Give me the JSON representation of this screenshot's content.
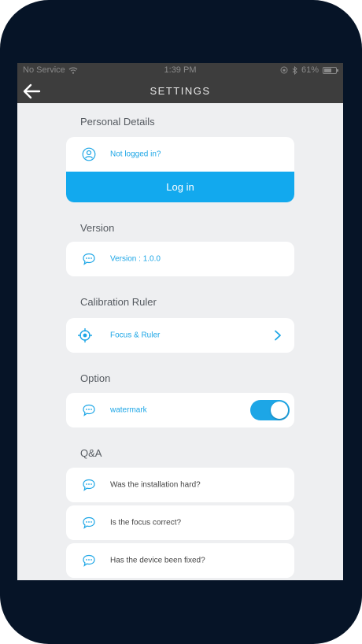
{
  "status_bar": {
    "carrier": "No Service",
    "time": "1:39 PM",
    "battery": "61%"
  },
  "nav": {
    "title": "SETTINGS"
  },
  "sections": {
    "personal": "Personal Details",
    "version": "Version",
    "calibration": "Calibration Ruler",
    "option": "Option",
    "qa": "Q&A"
  },
  "personal": {
    "status_text": "Not logged in?",
    "login_label": "Log in"
  },
  "version": {
    "text": "Version : 1.0.0"
  },
  "calibration": {
    "item_label": "Focus & Ruler"
  },
  "option": {
    "watermark_label": "watermark",
    "watermark_enabled": true
  },
  "qa": {
    "items": [
      "Was the installation hard?",
      "Is the focus correct?",
      "Has the device been fixed?"
    ]
  },
  "colors": {
    "accent": "#1da6e6",
    "login_button": "#12a9ee",
    "bar": "#3d3d3d",
    "background": "#eeeff1",
    "phone_frame": "#061427"
  },
  "icons": {
    "back": "arrow-left-icon",
    "user": "user-circle-icon",
    "chat": "chat-bubble-icon",
    "target": "crosshair-target-icon",
    "chevron": "chevron-right-icon",
    "wifi": "wifi-icon",
    "bluetooth": "bluetooth-icon",
    "lock": "orientation-lock-icon",
    "battery": "battery-icon"
  }
}
